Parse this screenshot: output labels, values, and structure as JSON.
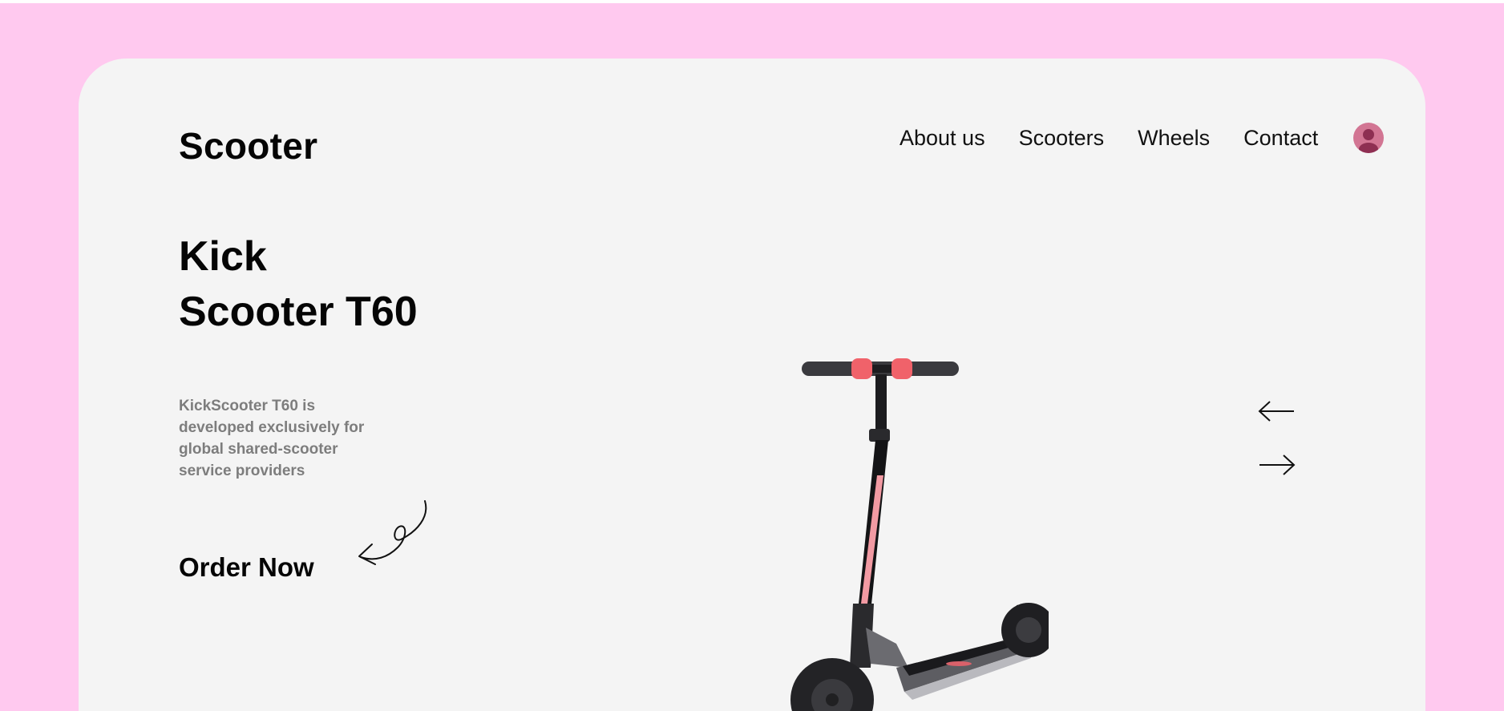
{
  "header": {
    "brand": "Scooter",
    "nav": [
      "About us",
      "Scooters",
      "Wheels",
      "Contact"
    ]
  },
  "hero": {
    "title_line1": "Kick",
    "title_line2": "Scooter T60",
    "description": "KickScooter T60 is developed exclusively for global shared-scooter service providers",
    "cta": "Order Now"
  },
  "colors": {
    "page_background": "#ffc9ef",
    "card_background": "#f4f4f4",
    "accent": "#d27593"
  },
  "icons": {
    "avatar": "user-icon",
    "prev": "arrow-left-icon",
    "next": "arrow-right-icon",
    "decoration": "curly-arrow-icon"
  }
}
